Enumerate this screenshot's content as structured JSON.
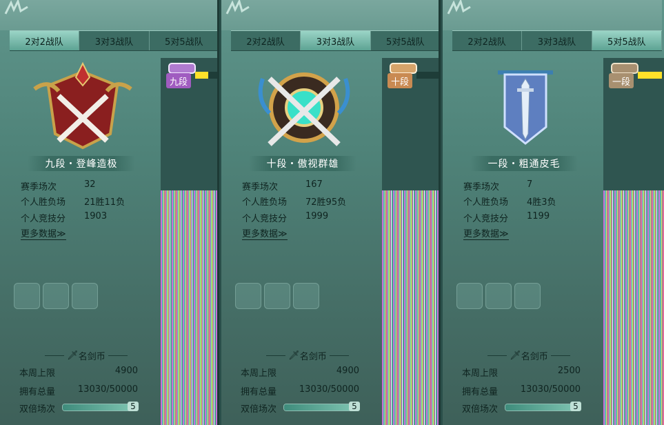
{
  "panels": [
    {
      "tabs": [
        "2对2战队",
        "3对3战队",
        "5对5战队"
      ],
      "active_tab": 0,
      "rank_title": "九段・登峰造极",
      "stats": [
        {
          "label": "赛季场次",
          "value": "32"
        },
        {
          "label": "个人胜负场",
          "value": "21胜11负"
        },
        {
          "label": "个人竞技分",
          "value": "1903"
        }
      ],
      "more_link": "更多数据≫",
      "coin_title": "名剑币",
      "weekly_cap_label": "本周上限",
      "weekly_cap_value": "4900",
      "owned_label": "拥有总量",
      "owned_value": "13030/50000",
      "double_label": "双倍场次",
      "double_value": "5",
      "double_progress": 1.0,
      "side_badge": "九段",
      "side_badge_color": "#a05cc0",
      "side_bar_progress": 0.55,
      "emblem": "nine-dan-crest-icon"
    },
    {
      "tabs": [
        "2对2战队",
        "3对3战队",
        "5对5战队"
      ],
      "active_tab": 1,
      "rank_title": "十段・傲视群雄",
      "stats": [
        {
          "label": "赛季场次",
          "value": "167"
        },
        {
          "label": "个人胜负场",
          "value": "72胜95负"
        },
        {
          "label": "个人竞技分",
          "value": "1999"
        }
      ],
      "more_link": "更多数据≫",
      "coin_title": "名剑币",
      "weekly_cap_label": "本周上限",
      "weekly_cap_value": "4900",
      "owned_label": "拥有总量",
      "owned_value": "13030/50000",
      "double_label": "双倍场次",
      "double_value": "5",
      "double_progress": 1.0,
      "side_badge": "十段",
      "side_badge_color": "#c98a52",
      "side_bar_progress": 0.0,
      "emblem": "ten-dan-crest-icon"
    },
    {
      "tabs": [
        "2对2战队",
        "3对3战队",
        "5对5战队"
      ],
      "active_tab": 2,
      "rank_title": "一段・粗通皮毛",
      "stats": [
        {
          "label": "赛季场次",
          "value": "7"
        },
        {
          "label": "个人胜负场",
          "value": "4胜3负"
        },
        {
          "label": "个人竞技分",
          "value": "1199"
        }
      ],
      "more_link": "更多数据≫",
      "coin_title": "名剑币",
      "weekly_cap_label": "本周上限",
      "weekly_cap_value": "2500",
      "owned_label": "拥有总量",
      "owned_value": "13030/50000",
      "double_label": "双倍场次",
      "double_value": "5",
      "double_progress": 1.0,
      "side_badge": "一段",
      "side_badge_color": "#a89070",
      "side_bar_progress": 1.0,
      "emblem": "one-dan-banner-icon"
    }
  ]
}
